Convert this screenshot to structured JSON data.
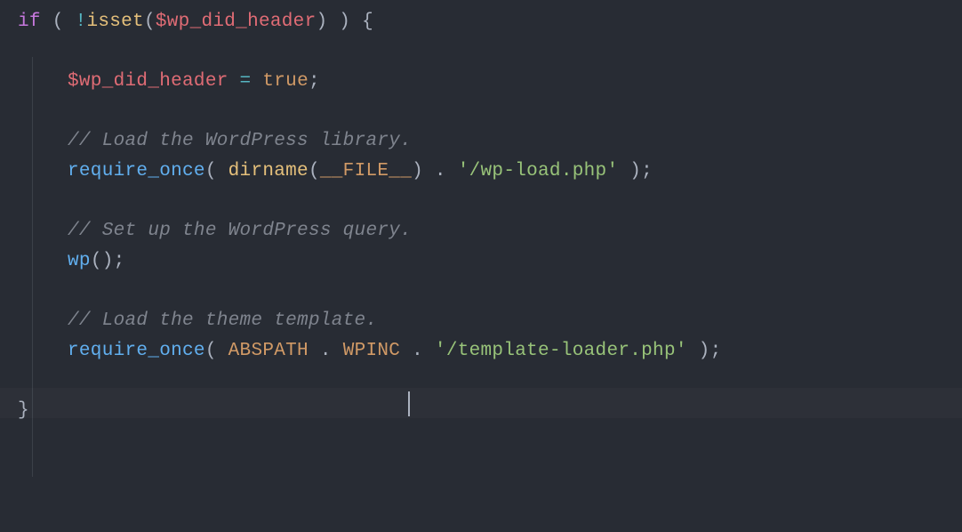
{
  "code": {
    "line1": {
      "if": "if",
      "open_paren": " ( ",
      "not": "!",
      "isset": "isset",
      "open_call": "(",
      "var": "$wp_did_header",
      "close_call": ")",
      "close_paren": " ) ",
      "brace": "{"
    },
    "line3": {
      "var": "$wp_did_header",
      "eq": " = ",
      "true": "true",
      "semi": ";"
    },
    "line5": {
      "comment": "// Load the WordPress library."
    },
    "line6": {
      "require": "require_once",
      "open": "( ",
      "dirname": "dirname",
      "open2": "(",
      "file": "__FILE__",
      "close2": ")",
      "concat": " . ",
      "string": "'/wp-load.php'",
      "close": " );"
    },
    "line8": {
      "comment": "// Set up the WordPress query."
    },
    "line9": {
      "wp": "wp",
      "call": "();"
    },
    "line11": {
      "comment": "// Load the theme template."
    },
    "line12": {
      "require": "require_once",
      "open": "( ",
      "abspath": "ABSPATH",
      "concat1": " . ",
      "wpinc": "WPINC",
      "concat2": " . ",
      "string": "'/template-loader.php'",
      "close": " );"
    },
    "line14": {
      "brace": "}"
    }
  }
}
